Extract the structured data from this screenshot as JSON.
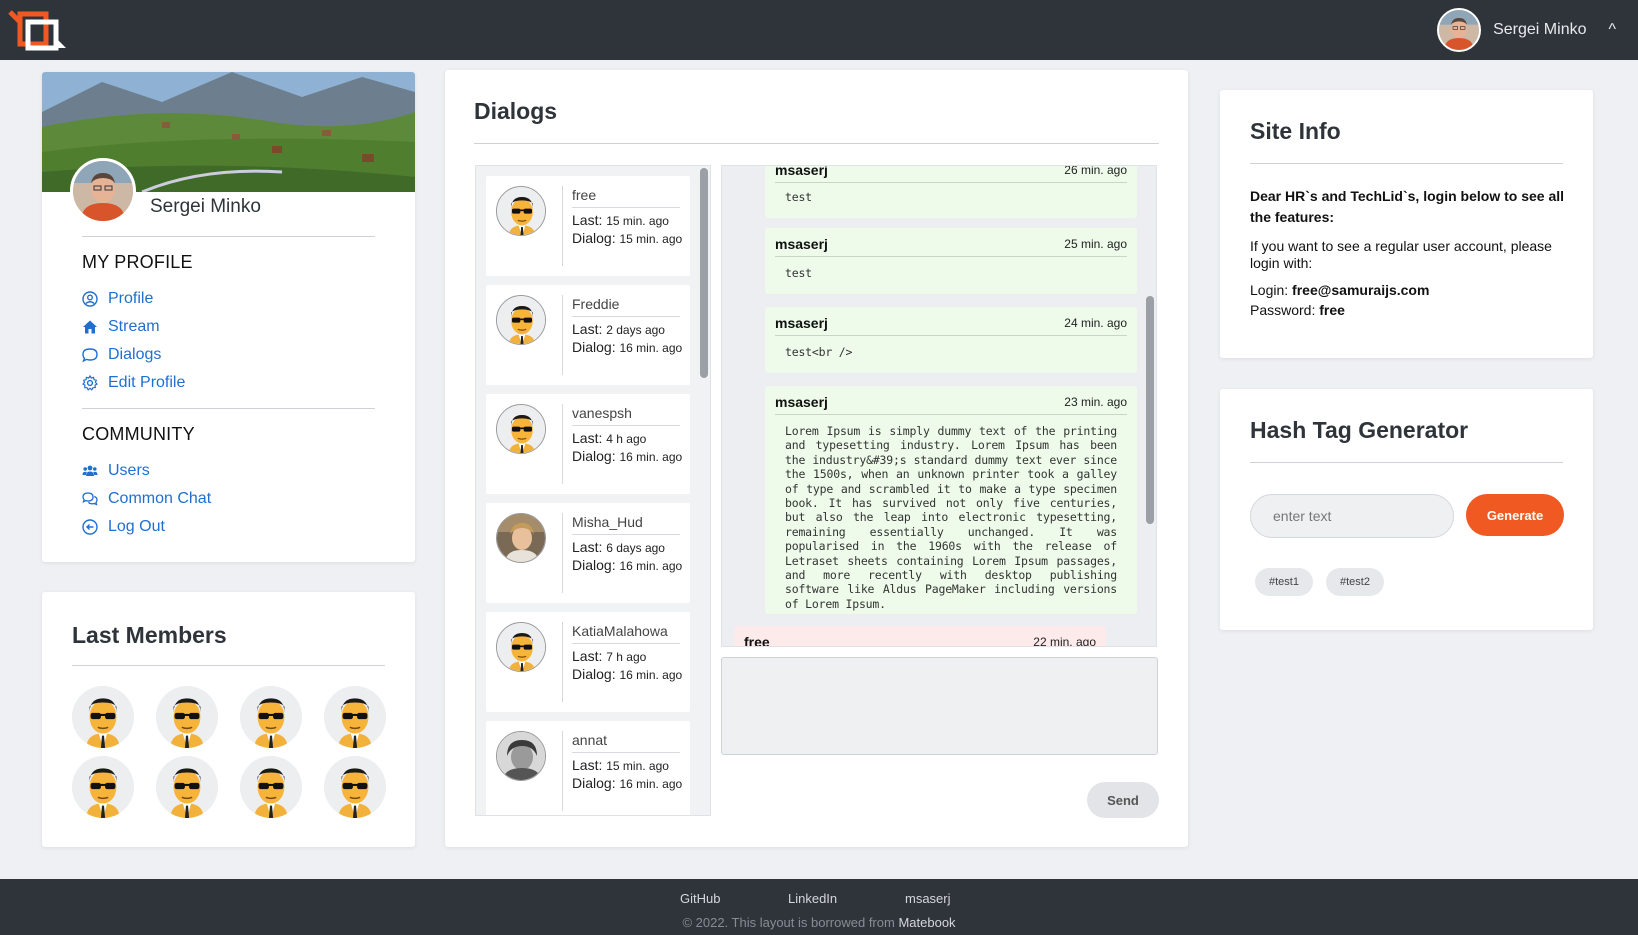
{
  "header": {
    "user_name": "Sergei Minko",
    "caret": "^"
  },
  "profile": {
    "name": "Sergei Minko",
    "my_profile_title": "MY PROFILE",
    "community_title": "COMMUNITY",
    "nav": [
      {
        "label": "Profile",
        "icon": "user-circle-icon"
      },
      {
        "label": "Stream",
        "icon": "home-icon"
      },
      {
        "label": "Dialogs",
        "icon": "chat-bubble-icon"
      },
      {
        "label": "Edit Profile",
        "icon": "gear-icon"
      }
    ],
    "community": [
      {
        "label": "Users",
        "icon": "users-icon"
      },
      {
        "label": "Common Chat",
        "icon": "chats-icon"
      },
      {
        "label": "Log Out",
        "icon": "logout-icon"
      }
    ]
  },
  "members": {
    "title": "Last Members"
  },
  "dialogs": {
    "title": "Dialogs",
    "list": [
      {
        "name": "free",
        "last_label": "Last:",
        "last": "15 min. ago",
        "dialog_label": "Dialog:",
        "dialog": "15 min. ago"
      },
      {
        "name": "Freddie",
        "last_label": "Last:",
        "last": "2 days ago",
        "dialog_label": "Dialog:",
        "dialog": "16 min. ago"
      },
      {
        "name": "vanespsh",
        "last_label": "Last:",
        "last": "4 h ago",
        "dialog_label": "Dialog:",
        "dialog": "16 min. ago"
      },
      {
        "name": "Misha_Hud",
        "last_label": "Last:",
        "last": "6 days ago",
        "dialog_label": "Dialog:",
        "dialog": "16 min. ago"
      },
      {
        "name": "KatiaMalahowa",
        "last_label": "Last:",
        "last": "7 h ago",
        "dialog_label": "Dialog:",
        "dialog": "16 min. ago"
      },
      {
        "name": "annat",
        "last_label": "Last:",
        "last": "15 min. ago",
        "dialog_label": "Dialog:",
        "dialog": "16 min. ago"
      }
    ],
    "messages": [
      {
        "author": "msaserj",
        "time": "26 min. ago",
        "text": "test"
      },
      {
        "author": "msaserj",
        "time": "25 min. ago",
        "text": "test"
      },
      {
        "author": "msaserj",
        "time": "24 min. ago",
        "text": "test<br />"
      },
      {
        "author": "msaserj",
        "time": "23 min. ago",
        "text": "Lorem Ipsum is simply dummy text of the printing and typesetting industry. Lorem Ipsum has been the industry&#39;s standard dummy text ever since the 1500s, when an unknown printer took a galley of type and scrambled it to make a type specimen book. It has survived not only five centuries, but also the leap into electronic typesetting, remaining essentially unchanged. It was popularised in the 1960s with the release of Letraset sheets containing Lorem Ipsum passages, and more recently with desktop publishing software like Aldus PageMaker including versions of Lorem Ipsum."
      },
      {
        "author": "free",
        "time": "22 min. ago",
        "text": ""
      }
    ],
    "send_label": "Send"
  },
  "site_info": {
    "title": "Site Info",
    "intro": "Dear HR`s and TechLid`s, login below to see all the features:",
    "regular": "If you want to see a regular user account, please login with:",
    "login_label": "Login:",
    "login_value": "free@samuraijs.com",
    "password_label": "Password:",
    "password_value": "free"
  },
  "hashtag": {
    "title": "Hash Tag Generator",
    "placeholder": "enter text",
    "button": "Generate",
    "tags": [
      "#test1",
      "#test2"
    ]
  },
  "footer": {
    "links": [
      "GitHub",
      "LinkedIn",
      "msaserj"
    ],
    "copyright": "© 2022. This layout is borrowed from",
    "copyright_link": "Matebook"
  },
  "colors": {
    "header_bg": "#2f343b",
    "link": "#1f6fd1",
    "accent": "#f05a22",
    "message_mine": "#eefbea",
    "message_other": "#fdeaea"
  }
}
